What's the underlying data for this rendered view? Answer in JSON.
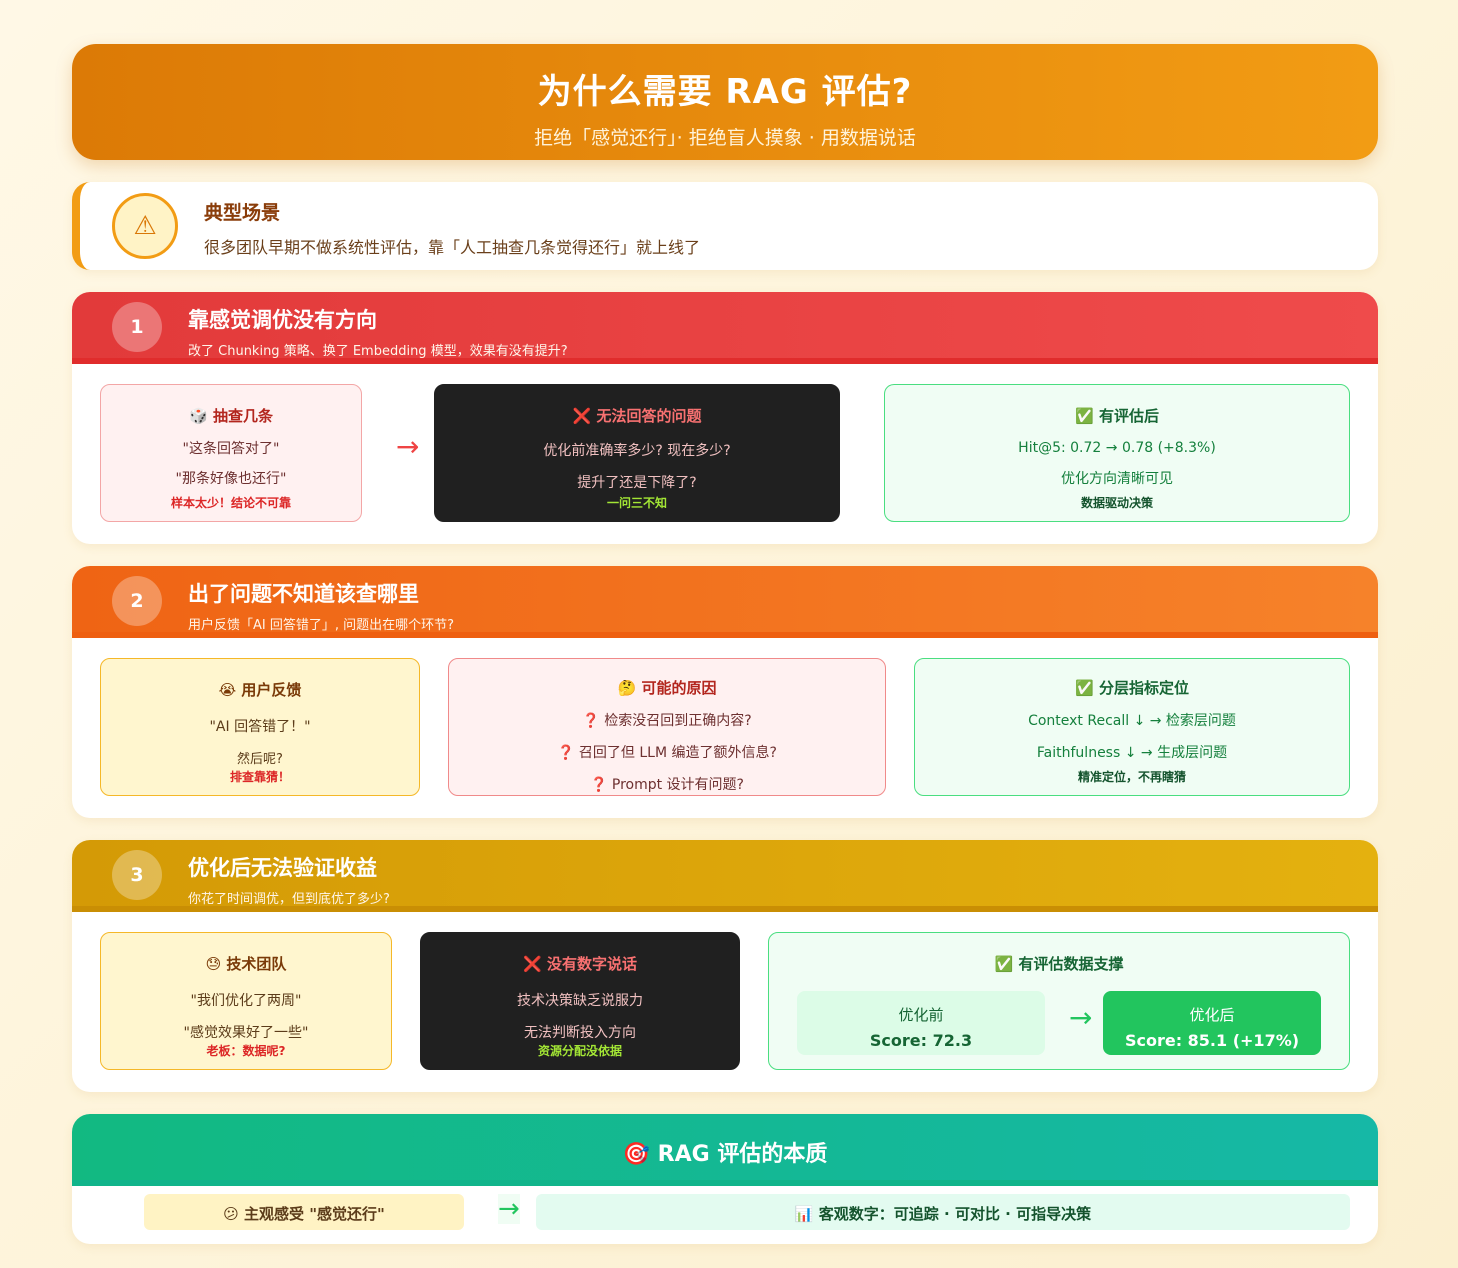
{
  "hero": {
    "title": "为什么需要 RAG 评估?",
    "subtitle": "拒绝「感觉还行」· 拒绝盲人摸象 · 用数据说话"
  },
  "scene": {
    "icon": "warning-icon",
    "title": "典型场景",
    "text": "很多团队早期不做系统性评估，靠「人工抽查几条觉得还行」就上线了"
  },
  "sections": [
    {
      "num": "1",
      "title": "靠感觉调优没有方向",
      "subtitle": "改了 Chunking 策略、换了 Embedding 模型，效果有没有提升?",
      "left": {
        "title": "🎲 抽查几条",
        "lines": [
          "\"这条回答对了\"",
          "\"那条好像也还行\""
        ],
        "foot": "样本太少！结论不可靠"
      },
      "middle": {
        "title": "❌ 无法回答的问题",
        "lines": [
          "优化前准确率多少? 现在多少?",
          "提升了还是下降了?"
        ],
        "foot": "一问三不知"
      },
      "right": {
        "title": "✅ 有评估后",
        "lines": [
          "Hit@5: 0.72 → 0.78 (+8.3%)",
          "优化方向清晰可见"
        ],
        "foot": "数据驱动决策"
      }
    },
    {
      "num": "2",
      "title": "出了问题不知道该查哪里",
      "subtitle": "用户反馈「AI 回答错了」, 问题出在哪个环节?",
      "left": {
        "title": "😭 用户反馈",
        "lines": [
          "\"AI 回答错了！\"",
          "然后呢?"
        ],
        "foot": "排查靠猜！"
      },
      "middle": {
        "title": "🤔 可能的原因",
        "lines": [
          "❓ 检索没召回到正确内容?",
          "❓ 召回了但 LLM 编造了额外信息?",
          "❓ Prompt 设计有问题?"
        ],
        "foot": ""
      },
      "right": {
        "title": "✅ 分层指标定位",
        "lines": [
          "Context Recall ↓ → 检索层问题",
          "Faithfulness ↓ → 生成层问题"
        ],
        "foot": "精准定位，不再瞎猜"
      }
    },
    {
      "num": "3",
      "title": "优化后无法验证收益",
      "subtitle": "你花了时间调优，但到底优了多少?",
      "left": {
        "title": "😓 技术团队",
        "lines": [
          "\"我们优化了两周\"",
          "\"感觉效果好了一些\""
        ],
        "foot": "老板：数据呢?"
      },
      "middle": {
        "title": "❌ 没有数字说话",
        "lines": [
          "技术决策缺乏说服力",
          "无法判断投入方向"
        ],
        "foot": "资源分配没依据"
      },
      "right": {
        "title": "✅ 有评估数据支撑",
        "before_label": "优化前",
        "before_value": "Score: 72.3",
        "after_label": "优化后",
        "after_value": "Score: 85.1 (+17%)"
      }
    }
  ],
  "arrow": "→",
  "essence": {
    "title": "🎯 RAG 评估的本质",
    "left": "😕 主观感受 \"感觉还行\"",
    "right": "📊 客观数字：可追踪 · 可对比 · 可指导决策"
  },
  "colors": {
    "hero": "#f29c14",
    "red": "#ef4444",
    "orange": "#f6822a",
    "gold": "#e4b10f",
    "green": "#22c55e",
    "teal": "#14b8a6"
  }
}
